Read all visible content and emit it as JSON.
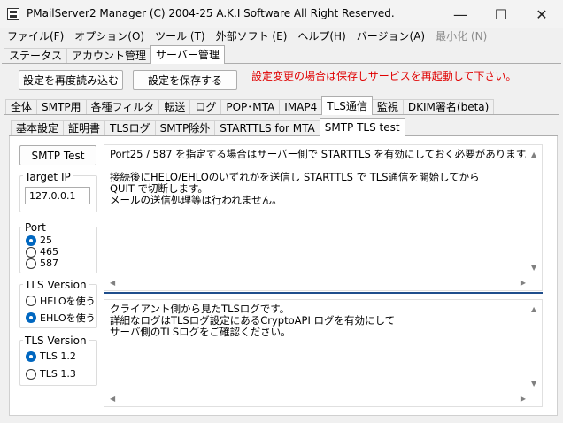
{
  "window": {
    "title": "PMailServer2 Manager (C) 2004-25 A.K.I Software All Right Reserved.",
    "minimize_glyph": "—",
    "maximize_glyph": "☐",
    "close_glyph": "✕"
  },
  "menu": [
    "ファイル(F)",
    "オプション(O)",
    "ツール (T)",
    "外部ソフト (E)",
    "ヘルプ(H)",
    "バージョン(A)",
    "最小化 (N)"
  ],
  "top_tabs": [
    "ステータス",
    "アカウント管理",
    "サーバー管理"
  ],
  "toolbar": {
    "reload_label": "設定を再度読み込む",
    "save_label": "設定を保存する",
    "notice": "設定変更の場合は保存しサービスを再起動して下さい。"
  },
  "server_tabs": [
    "全体",
    "SMTP用",
    "各種フィルタ",
    "転送",
    "ログ",
    "POP･MTA",
    "IMAP4",
    "TLS通信",
    "監視",
    "DKIM署名(beta)"
  ],
  "tls_tabs": [
    "基本設定",
    "証明書",
    "TLSログ",
    "SMTP除外",
    "STARTTLS for MTA",
    "SMTP TLS test"
  ],
  "left_panel": {
    "smtp_test_label": "SMTP Test",
    "target_ip_label": "Target IP",
    "target_ip_value": "127.0.0.1",
    "port_label": "Port",
    "ports": [
      "25",
      "465",
      "587"
    ],
    "port_selected": "25",
    "tls_version_group1_label": "TLS Version",
    "helo_label": "HELOを使う",
    "ehlo_label": "EHLOを使う",
    "hello_selected": "EHLOを使う",
    "tls_version_group2_label": "TLS Version",
    "tls_options": [
      "TLS 1.2",
      "TLS 1.3"
    ],
    "tls_selected": "TLS 1.2"
  },
  "server_log": "Port25 / 587 を指定する場合はサーバー側で STARTTLS を有効にしておく必要があります。\n\n接続後にHELO/EHLOのいずれかを送信し STARTTLS で TLS通信を開始してから\nQUIT で切断します。\nメールの送信処理等は行われません。",
  "client_log": "クライアント側から見たTLSログです。\n詳細なログはTLSログ設定にあるCryptoAPI ログを有効にして\nサーバ側のTLSログをご確認ください。",
  "scroll": {
    "up": "▲",
    "down": "▼",
    "left": "◀",
    "right": "▶"
  },
  "colors": {
    "accent": "#0067c0",
    "notice": "#e00000",
    "divider": "#1f4e8c"
  }
}
